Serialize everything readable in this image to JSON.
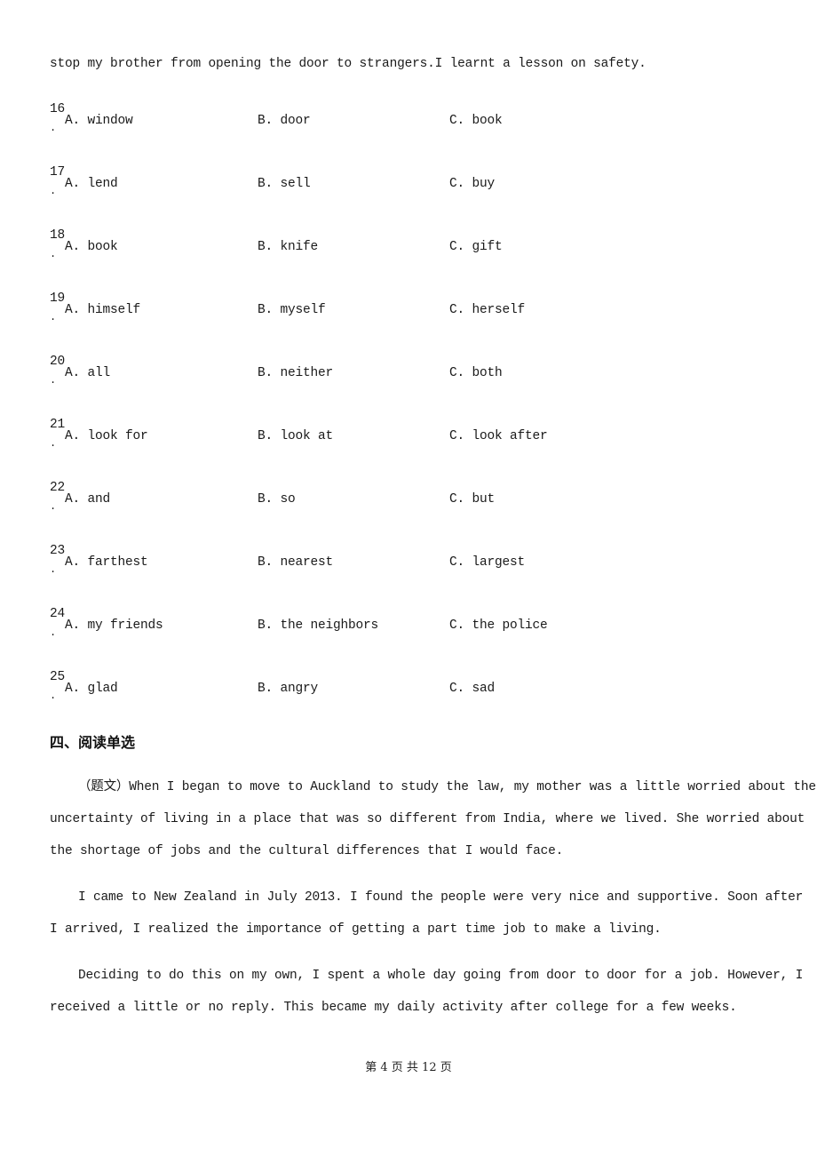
{
  "intro_line": "stop my brother from opening the door to strangers.I learnt a lesson on safety.",
  "questions": [
    {
      "number": "16",
      "dot": ".",
      "a": "A. window",
      "b": "B. door",
      "c": "C. book"
    },
    {
      "number": "17",
      "dot": ".",
      "a": "A. lend",
      "b": "B. sell",
      "c": "C. buy"
    },
    {
      "number": "18",
      "dot": ".",
      "a": "A. book",
      "b": "B. knife",
      "c": "C. gift"
    },
    {
      "number": "19",
      "dot": ".",
      "a": "A. himself",
      "b": "B. myself",
      "c": "C. herself"
    },
    {
      "number": "20",
      "dot": ".",
      "a": "A. all",
      "b": "B. neither",
      "c": "C. both"
    },
    {
      "number": "21",
      "dot": ".",
      "a": "A. look for",
      "b": "B. look at",
      "c": "C. look after"
    },
    {
      "number": "22",
      "dot": ".",
      "a": "A. and",
      "b": "B. so",
      "c": "C. but"
    },
    {
      "number": "23",
      "dot": ".",
      "a": "A. farthest",
      "b": "B. nearest",
      "c": "C. largest"
    },
    {
      "number": "24",
      "dot": ".",
      "a": "A. my friends",
      "b": "B. the neighbors",
      "c": "C. the police"
    },
    {
      "number": "25",
      "dot": ".",
      "a": "A. glad",
      "b": "B. angry",
      "c": "C. sad"
    }
  ],
  "section": {
    "title": "四、阅读单选"
  },
  "passage": {
    "paragraphs": [
      {
        "lines": [
          "（题文）When I began to move to Auckland to study the law, my mother was a little worried about the",
          "uncertainty of living in a place that was so different from India, where we lived. She worried about",
          "the shortage of jobs and the cultural differences that I would face."
        ]
      },
      {
        "lines": [
          "I came to New Zealand in July 2013. I found the people were very nice and supportive. Soon after",
          "I arrived, I realized the importance of getting a part time job to make a living."
        ]
      },
      {
        "lines": [
          "Deciding to do this on my own, I spent a whole day going from door to door for a job. However, I",
          "received a little or no reply. This became my daily activity after college for a few weeks."
        ]
      }
    ]
  },
  "footer": {
    "page_label": "第 4 页 共 12 页"
  }
}
